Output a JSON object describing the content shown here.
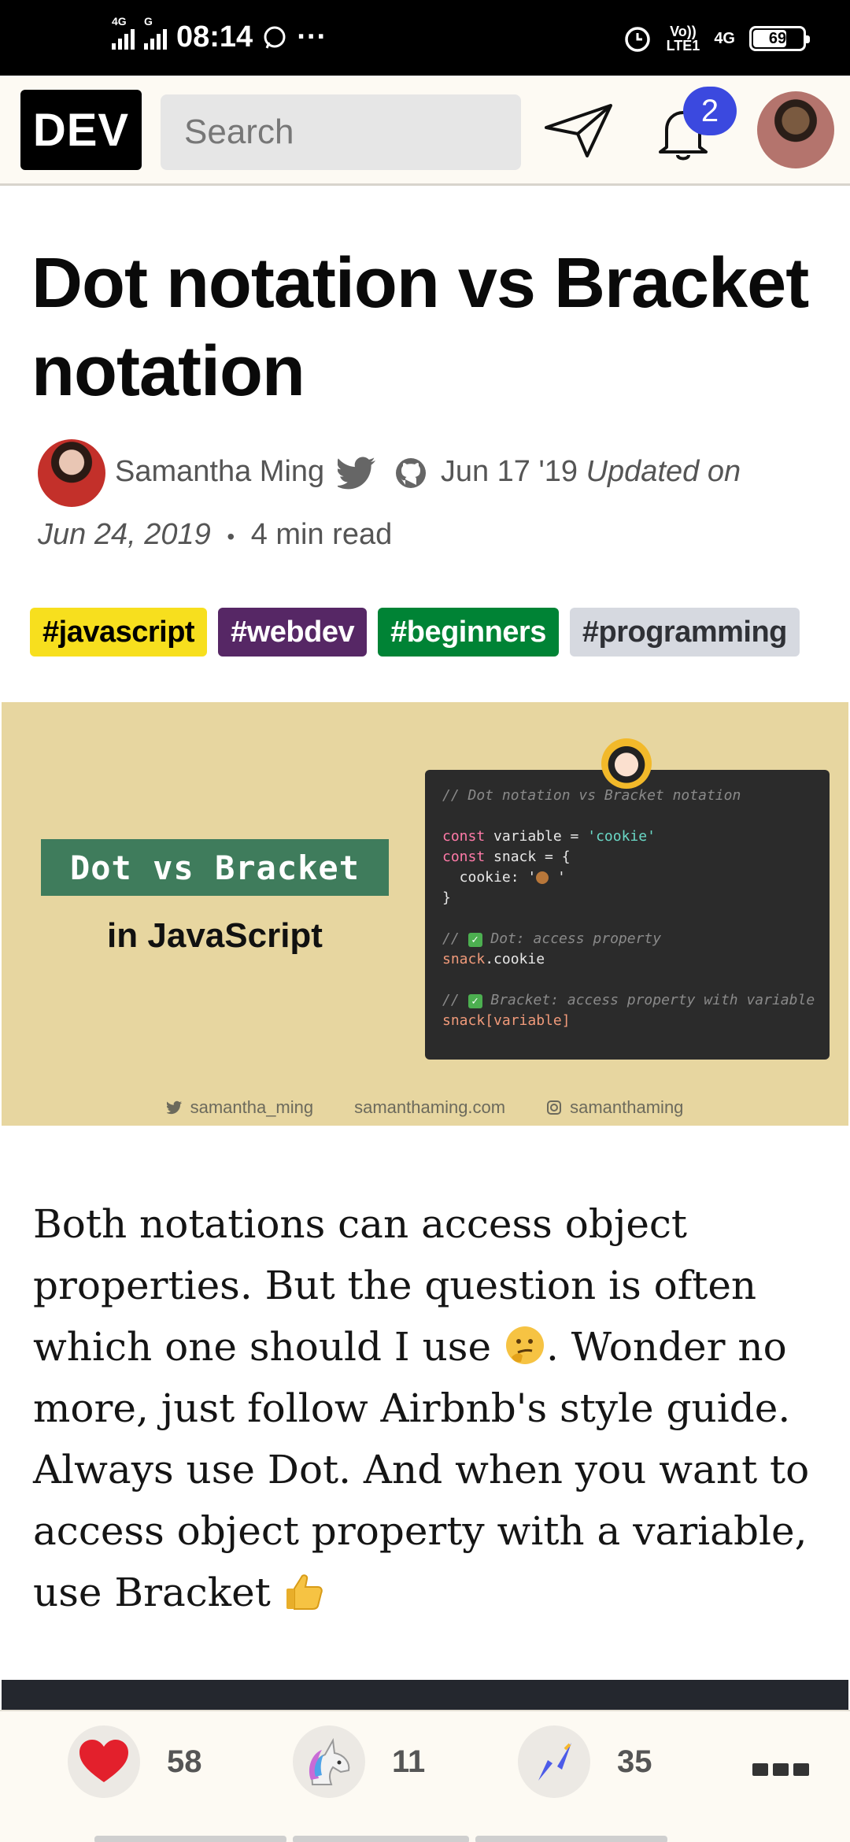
{
  "status_bar": {
    "time": "08:14",
    "network_left_1": "4G",
    "network_left_2": "G",
    "volte": "Vo))\nLTE1",
    "network_right": "4G",
    "battery": "69"
  },
  "header": {
    "logo": "DEV",
    "search_placeholder": "Search",
    "notification_count": "2"
  },
  "article": {
    "title": "Dot notation vs Bracket notation",
    "author": "Samantha Ming",
    "date": "Jun 17 '19",
    "updated_label": "Updated on",
    "updated_date": "Jun 24, 2019",
    "separator": "•",
    "read_time": "4 min read",
    "tags": [
      {
        "label": "#javascript",
        "bg": "#f7df1e",
        "fg": "#000000"
      },
      {
        "label": "#webdev",
        "bg": "#562765",
        "fg": "#ffffff"
      },
      {
        "label": "#beginners",
        "bg": "#008335",
        "fg": "#ffffff"
      },
      {
        "label": "#programming",
        "bg": "#d6d9e0",
        "fg": "#2f3136"
      }
    ],
    "cover": {
      "badge": "Dot vs Bracket",
      "subtitle": "in JavaScript",
      "code": {
        "comment_title": "// Dot notation vs Bracket notation",
        "line1_kw": "const",
        "line1_rest": " variable = ",
        "line1_str": "'cookie'",
        "line2_kw": "const",
        "line2_rest": " snack = {",
        "line3": "  cookie: '",
        "line3_end": " '",
        "line4": "}",
        "comment_dot": " Dot: access property",
        "dot_obj": "snack",
        "dot_rest": ".cookie",
        "comment_bracket": " Bracket: access property with variable",
        "bracket_obj": "snack",
        "bracket_rest": "[variable]"
      },
      "footer": {
        "twitter": "samantha_ming",
        "site": "samanthaming.com",
        "instagram": "samanthaming"
      }
    },
    "body_1": "Both notations can access object properties. But the question is often which one should I use ",
    "body_2": ". Wonder no more, just follow Airbnb's style guide. Always use Dot. And when you want to access object property with a variable, use Bracket "
  },
  "reactions": {
    "likes": "58",
    "unicorns": "11",
    "bookmarks": "35"
  },
  "colors": {
    "accent": "#3b49df",
    "heart": "#e3202c"
  }
}
